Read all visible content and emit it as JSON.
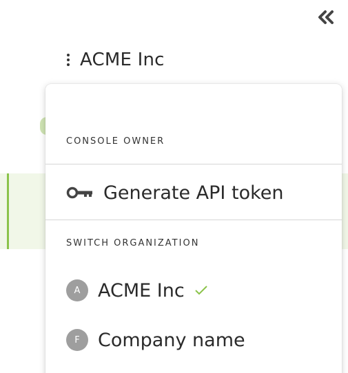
{
  "header": {
    "collapse_icon": "double-chevron-left-icon",
    "org_menu_icon": "kebab-menu-icon",
    "current_org": "ACME Inc"
  },
  "menu": {
    "owner_section_label": "CONSOLE OWNER",
    "generate_token": {
      "icon": "key-icon",
      "label": "Generate API token"
    },
    "switch_section_label": "SWITCH ORGANIZATION",
    "organizations": [
      {
        "initial": "A",
        "name": "ACME Inc",
        "selected": true
      },
      {
        "initial": "F",
        "name": "Company name",
        "selected": false
      }
    ]
  },
  "colors": {
    "accent_green": "#8bc34a",
    "avatar_gray": "#9e9e9e",
    "active_row_bg": "#f1f7e8"
  }
}
